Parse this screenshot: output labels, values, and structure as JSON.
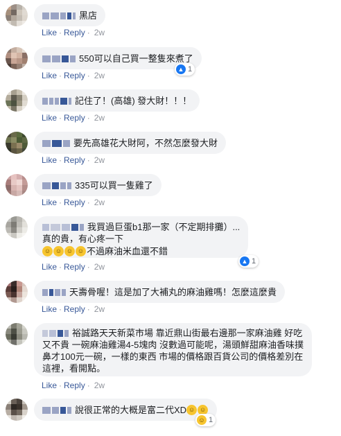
{
  "actions": {
    "like": "Like",
    "reply": "Reply",
    "time": "2w"
  },
  "comments": [
    {
      "suffix": "黑店"
    },
    {
      "text": "550可以自己買一整隻來煮了",
      "reactions": "1"
    },
    {
      "text": "記住了！(高雄) 發大財！！！"
    },
    {
      "text": "要先高雄花大財阿，不然怎麼發大財"
    },
    {
      "text": "335可以買一隻雞了"
    },
    {
      "line1": "我買過巨蛋b1那一家（不定期排攤）...",
      "line2": "真的貴，有心疼一下",
      "line3": "不過麻油米血還不錯",
      "reactions": "1"
    },
    {
      "text": "天壽骨喔！這是加了大補丸的麻油雞嗎！怎麼這麼貴"
    },
    {
      "line1": "裕誠路天天新菜市場 靠近鼎山街最右邊那一家麻油雞 好吃",
      "line2": "又不貴 一碗麻油雞湯4-5塊肉 沒數過可能呢，湯頭鮮甜麻油香味撲",
      "line3": "鼻才100元一碗，一樣的東西 市場的價格跟百貨公司的價格差別在",
      "line4": "這裡，看開點。"
    },
    {
      "text": "說很正常的大概是富二代XD",
      "reactions": "1"
    }
  ],
  "icons": {
    "like_reaction": "thumbs-up-icon",
    "haha_reaction": "laughing-face-icon"
  },
  "colors": {
    "link": "#385898",
    "bubble": "#f2f3f5",
    "like_blue": "#1877f2"
  }
}
